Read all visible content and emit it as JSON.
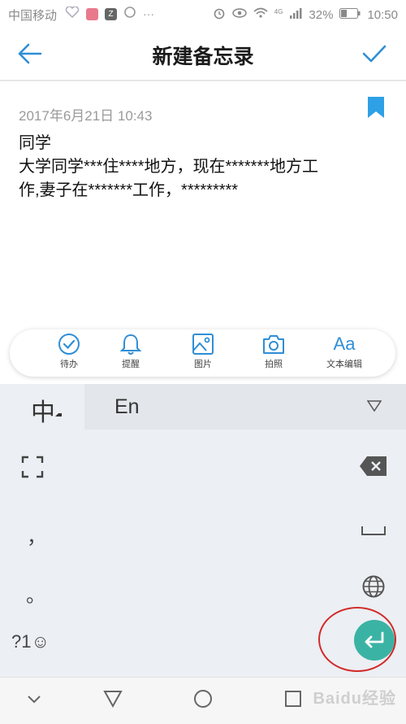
{
  "status_bar": {
    "carrier": "中国移动",
    "battery": "32%",
    "time": "10:50",
    "signal_tag": "4G"
  },
  "header": {
    "title": "新建备忘录"
  },
  "note": {
    "date": "2017年6月21日 10:43",
    "line1": "同学",
    "line2": "大学同学***住****地方，现在*******地方工",
    "line3": "作,妻子在*******工作，*********"
  },
  "toolbar": {
    "items": [
      {
        "label": "待办",
        "icon": "todo-check-icon"
      },
      {
        "label": "提醒",
        "icon": "bell-icon"
      },
      {
        "label": "图片",
        "icon": "image-icon"
      },
      {
        "label": "拍照",
        "icon": "camera-icon"
      },
      {
        "label": "文本编辑",
        "icon_text": "Aa"
      }
    ]
  },
  "keyboard": {
    "lang_zh": "中",
    "lang_en": "En",
    "comma": "，",
    "period": "。",
    "symbols": "?1☺"
  },
  "watermark": "Baidu经验",
  "colors": {
    "accent_blue": "#2f8ed6",
    "enter_teal": "#3bb3a4",
    "highlight_red": "#d22a2a"
  }
}
